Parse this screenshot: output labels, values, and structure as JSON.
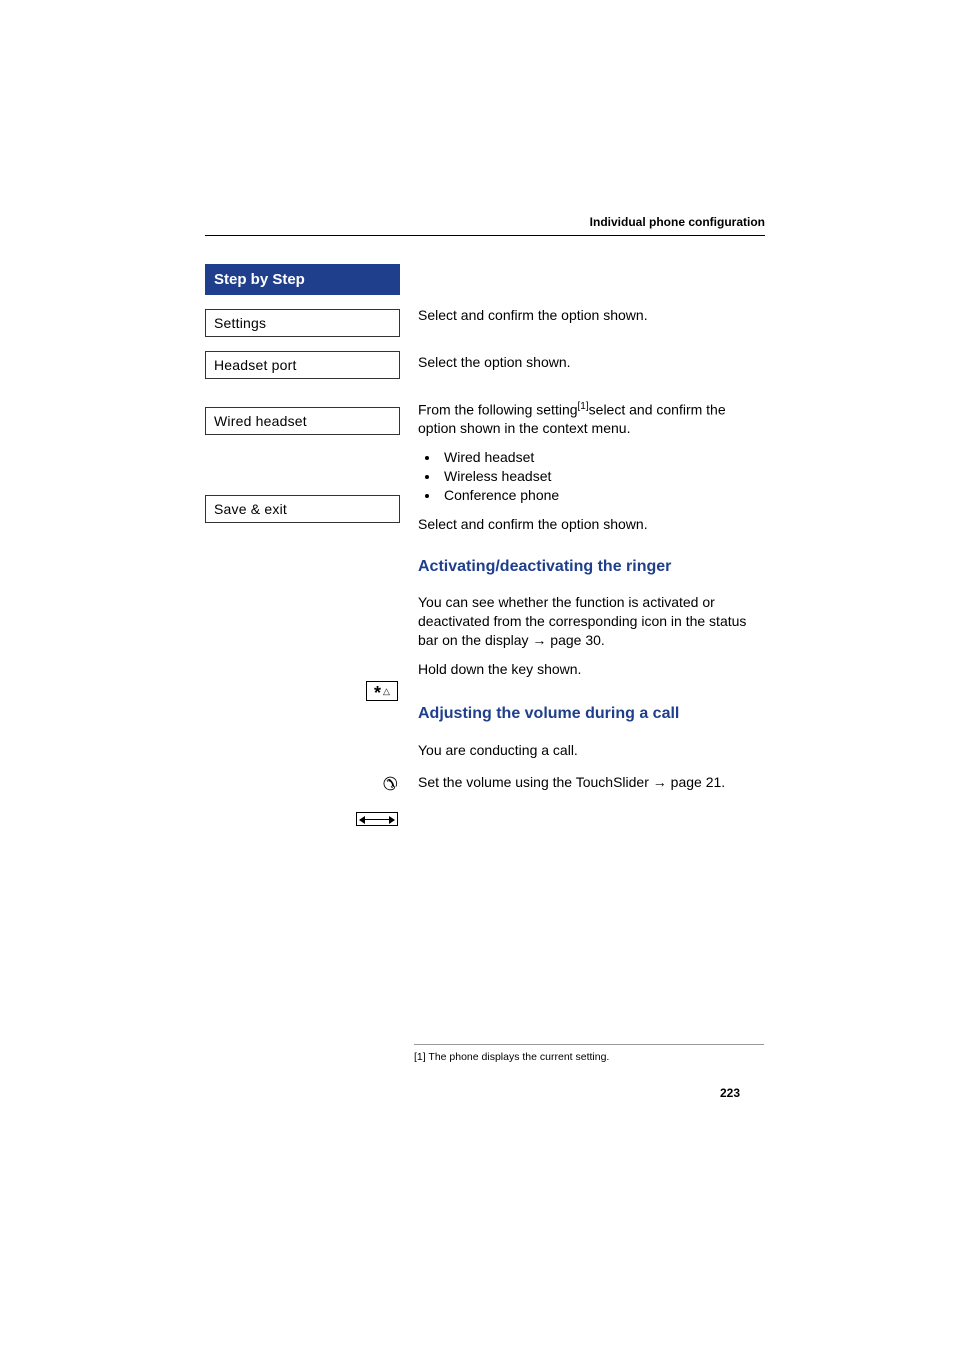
{
  "header": "Individual phone configuration",
  "step_header": "Step by Step",
  "menu": {
    "settings": "Settings",
    "headset_port": "Headset port",
    "wired_headset": "Wired headset",
    "save_exit": "Save & exit"
  },
  "body": {
    "settings_text": "Select and confirm the option shown.",
    "headset_text": "Select the option shown.",
    "wired_intro_a": "From the following setting",
    "wired_intro_sup": "[1]",
    "wired_intro_b": "select and confirm the option shown in the context menu.",
    "options": [
      "Wired headset",
      "Wireless headset",
      "Conference phone"
    ],
    "save_text": "Select and confirm the option shown.",
    "sec_ringer_title": "Activating/deactivating the ringer",
    "ringer_body_a": "You can see whether the function is activated or deactivated from the corresponding icon in the status bar on the display ",
    "ringer_body_arrow": "→",
    "ringer_body_b": " page 30.",
    "hold_key": "Hold down the key shown.",
    "sec_volume_title": "Adjusting the volume during a call",
    "conducting": "You are conducting a call.",
    "slider_a": "Set the volume using the TouchSlider ",
    "slider_arrow": "→",
    "slider_b": " page 21."
  },
  "footnote": "[1] The phone displays the current setting.",
  "page_number": "223"
}
